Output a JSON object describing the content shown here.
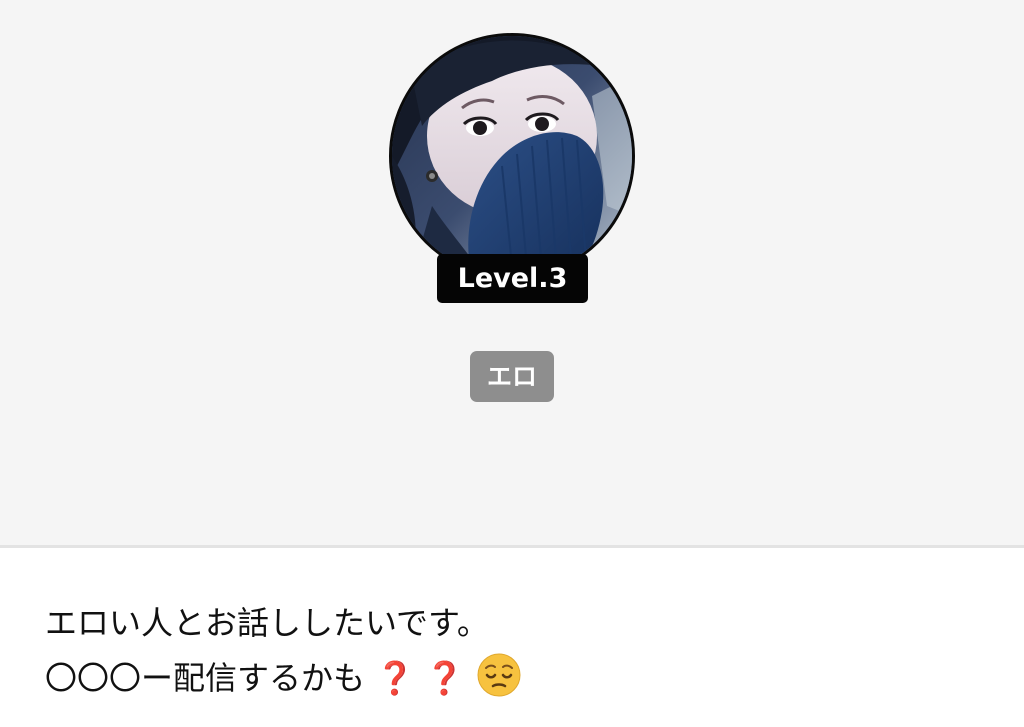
{
  "profile": {
    "avatar_alt": "profile photo",
    "level_label": "Level.3",
    "tag_label": "エロ"
  },
  "bio": {
    "line1": "エロい人とお話ししたいです。",
    "line2_text": "〇〇〇ー配信するかも",
    "question_mark": "❓",
    "emoji_icon": "pensive-face-icon"
  },
  "colors": {
    "header_bg": "#f5f5f5",
    "badge_bg": "#050505",
    "tag_bg": "#8e8e8e",
    "question_red": "#d51d2a",
    "emoji_yellow": "#f7c23f"
  }
}
